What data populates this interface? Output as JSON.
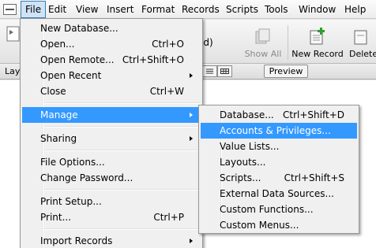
{
  "menubar": {
    "items": [
      {
        "label": "File",
        "active": true
      },
      {
        "label": "Edit"
      },
      {
        "label": "View"
      },
      {
        "label": "Insert"
      },
      {
        "label": "Format"
      },
      {
        "label": "Records"
      },
      {
        "label": "Scripts"
      },
      {
        "label": "Tools"
      },
      {
        "label": "Window"
      },
      {
        "label": "Help"
      }
    ]
  },
  "toolbar": {
    "records_fragment": "ed)",
    "show_all_label": "Show All",
    "new_record_label": "New Record",
    "delete_label": "Delete"
  },
  "layoutbar": {
    "layout_fragment": "Lay",
    "preview_label": "Preview"
  },
  "file_menu": {
    "items": [
      {
        "label": "New Database...",
        "shortcut": ""
      },
      {
        "label": "Open...",
        "shortcut": "Ctrl+O"
      },
      {
        "label": "Open Remote...",
        "shortcut": "Ctrl+Shift+O"
      },
      {
        "label": "Open Recent",
        "shortcut": ""
      },
      {
        "label": "Close",
        "shortcut": "Ctrl+W"
      },
      {
        "label": "Manage",
        "shortcut": ""
      },
      {
        "label": "Sharing",
        "shortcut": ""
      },
      {
        "label": "File Options...",
        "shortcut": ""
      },
      {
        "label": "Change Password...",
        "shortcut": ""
      },
      {
        "label": "Print Setup...",
        "shortcut": ""
      },
      {
        "label": "Print...",
        "shortcut": "Ctrl+P"
      },
      {
        "label": "Import Records",
        "shortcut": ""
      }
    ]
  },
  "manage_menu": {
    "items": [
      {
        "label": "Database...",
        "shortcut": "Ctrl+Shift+D"
      },
      {
        "label": "Accounts & Privileges...",
        "shortcut": ""
      },
      {
        "label": "Value Lists...",
        "shortcut": ""
      },
      {
        "label": "Layouts...",
        "shortcut": ""
      },
      {
        "label": "Scripts...",
        "shortcut": "Ctrl+Shift+S"
      },
      {
        "label": "External Data Sources...",
        "shortcut": ""
      },
      {
        "label": "Custom Functions...",
        "shortcut": ""
      },
      {
        "label": "Custom Menus...",
        "shortcut": ""
      }
    ]
  },
  "colors": {
    "highlight": "#3399ff",
    "menu_background": "#f0f0f0",
    "menubar_active": "#cfe3f7"
  }
}
